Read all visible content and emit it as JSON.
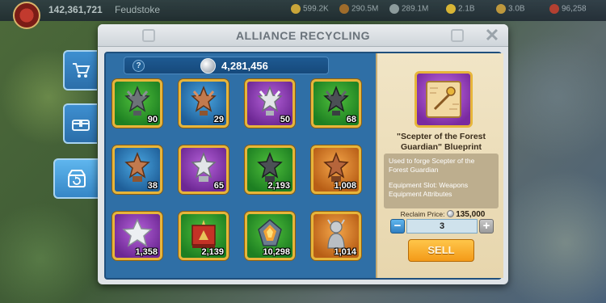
{
  "hud": {
    "power": "142,361,721",
    "player_name": "Feudstoke",
    "resources": [
      {
        "icon": "food-icon",
        "value": "599.2K",
        "color": "#e2b23a"
      },
      {
        "icon": "wood-icon",
        "value": "290.5M",
        "color": "#b0702a"
      },
      {
        "icon": "stone-icon",
        "value": "289.1M",
        "color": "#9aa6ad"
      },
      {
        "icon": "gold-icon",
        "value": "2.1B",
        "color": "#f1c432"
      },
      {
        "icon": "gem-icon",
        "value": "3.0B",
        "color": "#d2a23a"
      },
      {
        "icon": "crimson-icon",
        "value": "96,258",
        "color": "#c43a2a"
      }
    ]
  },
  "side_tabs": [
    {
      "icon": "cart-icon"
    },
    {
      "icon": "chest-icon"
    },
    {
      "icon": "recycle-icon"
    }
  ],
  "dialog": {
    "title": "ALLIANCE RECYCLING",
    "silver_total": "4,281,456"
  },
  "items": [
    {
      "name": "iron-star-item",
      "count": "90",
      "bg": "green"
    },
    {
      "name": "bronze-star-item",
      "count": "29",
      "bg": "blue"
    },
    {
      "name": "silver-star-item",
      "count": "50",
      "bg": "purple"
    },
    {
      "name": "dark-star-item",
      "count": "68",
      "bg": "green"
    },
    {
      "name": "bronze-star-blue-item",
      "count": "38",
      "bg": "blue"
    },
    {
      "name": "silver-star-purple-item",
      "count": "65",
      "bg": "purple"
    },
    {
      "name": "dark-star-green-item",
      "count": "2,193",
      "bg": "green"
    },
    {
      "name": "copper-star-orange-item",
      "count": "1,008",
      "bg": "orange"
    },
    {
      "name": "silver-star-lavender-item",
      "count": "1,358",
      "bg": "purple"
    },
    {
      "name": "war-banner-item",
      "count": "2,139",
      "bg": "green"
    },
    {
      "name": "gem-shard-item",
      "count": "10,298",
      "bg": "green"
    },
    {
      "name": "statue-item",
      "count": "1,014",
      "bg": "orange"
    }
  ],
  "detail": {
    "name": "\"Scepter of the Forest Guardian\" Blueprint",
    "description": "Used to forge Scepter of the Forest Guardian",
    "slot": "Equipment Slot: Weapons",
    "attributes": "Equipment Attributes",
    "reclaim_label": "Reclaim Price:",
    "reclaim_price": "135,000",
    "quantity": "3",
    "sell_label": "SELL"
  }
}
